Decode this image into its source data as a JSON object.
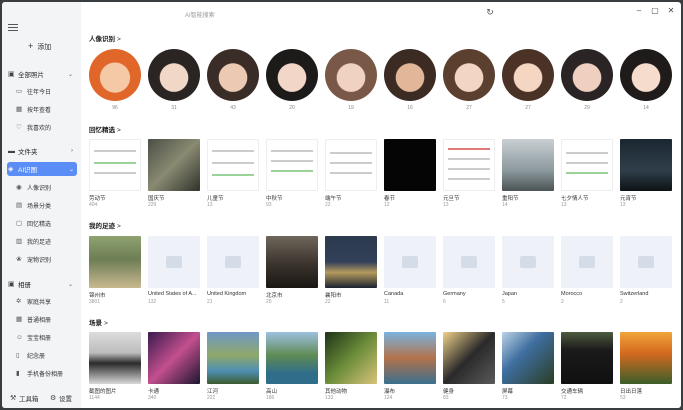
{
  "window": {
    "title": "AI智能搜索"
  },
  "sidebar": {
    "add_label": "添加",
    "sections": [
      {
        "label": "全部照片",
        "items": [
          "往年今日",
          "按年查看",
          "我喜欢的"
        ]
      },
      {
        "label": "文件夹",
        "items": []
      },
      {
        "label": "AI识图",
        "items": [
          "人像识别",
          "场景分类",
          "回忆精选",
          "我的足迹",
          "宠物识别"
        ]
      },
      {
        "label": "相册",
        "items": [
          "家庭共享",
          "普通相册",
          "宝宝相册",
          "纪念册",
          "手机备份相册"
        ]
      }
    ],
    "tools_label": "工具箱",
    "settings_label": "设置"
  },
  "people": {
    "title": "人像识别",
    "counts": [
      "96",
      "31",
      "43",
      "20",
      "19",
      "16",
      "27",
      "27",
      "29",
      "14"
    ]
  },
  "memories": {
    "title": "回忆精选",
    "items": [
      {
        "name": "劳动节",
        "count": "404"
      },
      {
        "name": "国庆节",
        "count": "229"
      },
      {
        "name": "儿童节",
        "count": "13"
      },
      {
        "name": "中秋节",
        "count": "93"
      },
      {
        "name": "端午节",
        "count": "22"
      },
      {
        "name": "春节",
        "count": "12"
      },
      {
        "name": "元旦节",
        "count": "13"
      },
      {
        "name": "重阳节",
        "count": "14"
      },
      {
        "name": "七夕情人节",
        "count": "13"
      },
      {
        "name": "元宵节",
        "count": "13"
      }
    ]
  },
  "footprints": {
    "title": "我的足迹",
    "items": [
      {
        "name": "锦州市",
        "count": "3801"
      },
      {
        "name": "United States of A...",
        "count": "132"
      },
      {
        "name": "United Kingdom",
        "count": "21"
      },
      {
        "name": "北京市",
        "count": "20"
      },
      {
        "name": "襄阳市",
        "count": "22"
      },
      {
        "name": "Canada",
        "count": "11"
      },
      {
        "name": "Germany",
        "count": "6"
      },
      {
        "name": "Japan",
        "count": "5"
      },
      {
        "name": "Morocco",
        "count": "2"
      },
      {
        "name": "Switzerland",
        "count": "2"
      }
    ]
  },
  "scenes": {
    "title": "场景",
    "items": [
      {
        "name": "截图的图片",
        "count": "1144"
      },
      {
        "name": "卡通",
        "count": "340"
      },
      {
        "name": "江河",
        "count": "222"
      },
      {
        "name": "高山",
        "count": "186"
      },
      {
        "name": "其他动物",
        "count": "133"
      },
      {
        "name": "瀑布",
        "count": "124"
      },
      {
        "name": "健身",
        "count": "83"
      },
      {
        "name": "屏幕",
        "count": "73"
      },
      {
        "name": "交通车辆",
        "count": "72"
      },
      {
        "name": "日出日落",
        "count": "53"
      }
    ]
  },
  "colors": {
    "accent": "#5b8df6",
    "sidebar_bg": "#f3f4f6"
  }
}
